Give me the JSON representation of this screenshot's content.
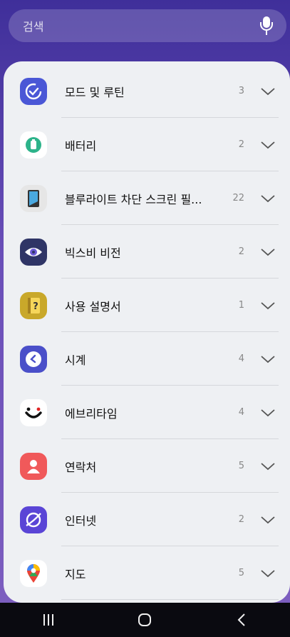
{
  "search": {
    "placeholder": "검색"
  },
  "items": [
    {
      "label": "모드 및 루틴",
      "count": "3",
      "icon": "routine-icon",
      "color": "#4a57d6"
    },
    {
      "label": "배터리",
      "count": "2",
      "icon": "battery-icon",
      "color": "#ffffff"
    },
    {
      "label": "블루라이트 차단 스크린 필...",
      "count": "22",
      "icon": "bluelight-filter-icon",
      "color": "#e6e6e6"
    },
    {
      "label": "빅스비 비전",
      "count": "2",
      "icon": "bixby-vision-icon",
      "color": "#2f3566"
    },
    {
      "label": "사용 설명서",
      "count": "1",
      "icon": "user-manual-icon",
      "color": "#c9a82a"
    },
    {
      "label": "시계",
      "count": "4",
      "icon": "clock-icon",
      "color": "#4a4fc9"
    },
    {
      "label": "에브리타임",
      "count": "4",
      "icon": "everytime-icon",
      "color": "#ffffff"
    },
    {
      "label": "연락처",
      "count": "5",
      "icon": "contacts-icon",
      "color": "#f0595a"
    },
    {
      "label": "인터넷",
      "count": "2",
      "icon": "internet-icon",
      "color": "#5a45d6"
    },
    {
      "label": "지도",
      "count": "5",
      "icon": "maps-icon",
      "color": "#ffffff"
    }
  ],
  "navbar": {
    "recents": "recents-icon",
    "home": "home-icon",
    "back": "back-icon"
  }
}
